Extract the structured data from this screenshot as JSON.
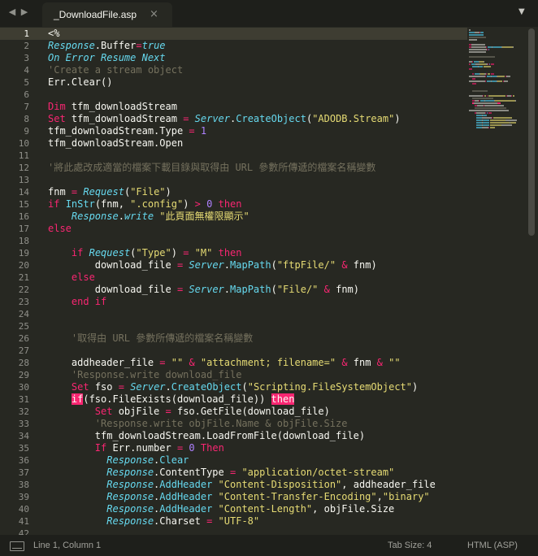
{
  "nav": {
    "back": "◀",
    "forward": "▶"
  },
  "tab": {
    "label": "_DownloadFile.asp",
    "close": "×"
  },
  "tab_menu": "▼",
  "lines": [
    {
      "n": "1",
      "p": [
        [
          "c",
          "<%"
        ]
      ]
    },
    {
      "n": "2",
      "p": [
        [
          "o",
          "Response"
        ],
        [
          "c",
          "."
        ],
        [
          "c",
          "Buffer"
        ],
        [
          "k",
          "="
        ],
        [
          "o",
          "true"
        ]
      ]
    },
    {
      "n": "3",
      "p": [
        [
          "o",
          "On Error Resume Next"
        ]
      ]
    },
    {
      "n": "4",
      "p": [
        [
          "m",
          "'Create a stream object"
        ]
      ]
    },
    {
      "n": "5",
      "p": [
        [
          "c",
          "Err.Clear()"
        ]
      ]
    },
    {
      "n": "6",
      "p": []
    },
    {
      "n": "7",
      "p": [
        [
          "k",
          "Dim"
        ],
        [
          "c",
          " tfm_downloadStream"
        ]
      ]
    },
    {
      "n": "8",
      "p": [
        [
          "k",
          "Set"
        ],
        [
          "c",
          " tfm_downloadStream "
        ],
        [
          "k",
          "="
        ],
        [
          "c",
          " "
        ],
        [
          "o",
          "Server"
        ],
        [
          "c",
          "."
        ],
        [
          "f",
          "CreateObject"
        ],
        [
          "c",
          "("
        ],
        [
          "s",
          "\"ADODB.Stream\""
        ],
        [
          "c",
          ")"
        ]
      ]
    },
    {
      "n": "9",
      "p": [
        [
          "c",
          "tfm_downloadStream.Type "
        ],
        [
          "k",
          "="
        ],
        [
          "c",
          " "
        ],
        [
          "n",
          "1"
        ]
      ]
    },
    {
      "n": "10",
      "p": [
        [
          "c",
          "tfm_downloadStream.Open"
        ]
      ]
    },
    {
      "n": "11",
      "p": []
    },
    {
      "n": "12",
      "p": [
        [
          "m",
          "'將此處改成適當的檔案下載目錄與取得由 URL 參數所傳遞的檔案名稱變數"
        ]
      ]
    },
    {
      "n": "13",
      "p": []
    },
    {
      "n": "14",
      "p": [
        [
          "c",
          "fnm "
        ],
        [
          "k",
          "="
        ],
        [
          "c",
          " "
        ],
        [
          "o",
          "Request"
        ],
        [
          "c",
          "("
        ],
        [
          "s",
          "\"File\""
        ],
        [
          "c",
          ")"
        ]
      ]
    },
    {
      "n": "15",
      "p": [
        [
          "k",
          "if"
        ],
        [
          "c",
          " "
        ],
        [
          "f",
          "InStr"
        ],
        [
          "c",
          "(fnm, "
        ],
        [
          "s",
          "\".config\""
        ],
        [
          "c",
          ") "
        ],
        [
          "k",
          ">"
        ],
        [
          "c",
          " "
        ],
        [
          "n",
          "0"
        ],
        [
          "c",
          " "
        ],
        [
          "k",
          "then"
        ]
      ]
    },
    {
      "n": "16",
      "p": [
        [
          "c",
          "    "
        ],
        [
          "o",
          "Response"
        ],
        [
          "c",
          "."
        ],
        [
          "o",
          "write"
        ],
        [
          "c",
          " "
        ],
        [
          "s",
          "\"此頁面無權限顯示\""
        ]
      ]
    },
    {
      "n": "17",
      "p": [
        [
          "k",
          "else"
        ]
      ]
    },
    {
      "n": "18",
      "p": []
    },
    {
      "n": "19",
      "p": [
        [
          "c",
          "    "
        ],
        [
          "k",
          "if"
        ],
        [
          "c",
          " "
        ],
        [
          "o",
          "Request"
        ],
        [
          "c",
          "("
        ],
        [
          "s",
          "\"Type\""
        ],
        [
          "c",
          ") "
        ],
        [
          "k",
          "="
        ],
        [
          "c",
          " "
        ],
        [
          "s",
          "\"M\""
        ],
        [
          "c",
          " "
        ],
        [
          "k",
          "then"
        ]
      ]
    },
    {
      "n": "20",
      "p": [
        [
          "c",
          "        download_file "
        ],
        [
          "k",
          "="
        ],
        [
          "c",
          " "
        ],
        [
          "o",
          "Server"
        ],
        [
          "c",
          "."
        ],
        [
          "f",
          "MapPath"
        ],
        [
          "c",
          "("
        ],
        [
          "s",
          "\"ftpFile/\""
        ],
        [
          "c",
          " "
        ],
        [
          "k",
          "&"
        ],
        [
          "c",
          " fnm)"
        ]
      ]
    },
    {
      "n": "21",
      "p": [
        [
          "c",
          "    "
        ],
        [
          "k",
          "else"
        ]
      ]
    },
    {
      "n": "22",
      "p": [
        [
          "c",
          "        download_file "
        ],
        [
          "k",
          "="
        ],
        [
          "c",
          " "
        ],
        [
          "o",
          "Server"
        ],
        [
          "c",
          "."
        ],
        [
          "f",
          "MapPath"
        ],
        [
          "c",
          "("
        ],
        [
          "s",
          "\"File/\""
        ],
        [
          "c",
          " "
        ],
        [
          "k",
          "&"
        ],
        [
          "c",
          " fnm)"
        ]
      ]
    },
    {
      "n": "23",
      "p": [
        [
          "c",
          "    "
        ],
        [
          "k",
          "end if"
        ]
      ]
    },
    {
      "n": "24",
      "p": []
    },
    {
      "n": "25",
      "p": []
    },
    {
      "n": "26",
      "p": [
        [
          "c",
          "    "
        ],
        [
          "m",
          "'取得由 URL 參數所傳遞的檔案名稱變數"
        ]
      ]
    },
    {
      "n": "27",
      "p": []
    },
    {
      "n": "28",
      "p": [
        [
          "c",
          "    addheader_file "
        ],
        [
          "k",
          "="
        ],
        [
          "c",
          " "
        ],
        [
          "s",
          "\"\""
        ],
        [
          "c",
          " "
        ],
        [
          "k",
          "&"
        ],
        [
          "c",
          " "
        ],
        [
          "s",
          "\"attachment; filename=\""
        ],
        [
          "c",
          " "
        ],
        [
          "k",
          "&"
        ],
        [
          "c",
          " fnm "
        ],
        [
          "k",
          "&"
        ],
        [
          "c",
          " "
        ],
        [
          "s",
          "\"\""
        ]
      ]
    },
    {
      "n": "29",
      "p": [
        [
          "c",
          "    "
        ],
        [
          "m",
          "'Response.write download_file"
        ]
      ]
    },
    {
      "n": "30",
      "p": [
        [
          "c",
          "    "
        ],
        [
          "k",
          "Set"
        ],
        [
          "c",
          " fso "
        ],
        [
          "k",
          "="
        ],
        [
          "c",
          " "
        ],
        [
          "o",
          "Server"
        ],
        [
          "c",
          "."
        ],
        [
          "f",
          "CreateObject"
        ],
        [
          "c",
          "("
        ],
        [
          "s",
          "\"Scripting.FileSystemObject\""
        ],
        [
          "c",
          ")"
        ]
      ]
    },
    {
      "n": "31",
      "p": [
        [
          "c",
          "    "
        ],
        [
          "e",
          "if"
        ],
        [
          "c",
          "(fso.FileExists(download_file)) "
        ],
        [
          "e",
          "then"
        ]
      ]
    },
    {
      "n": "32",
      "p": [
        [
          "c",
          "        "
        ],
        [
          "k",
          "Set"
        ],
        [
          "c",
          " objFile "
        ],
        [
          "k",
          "="
        ],
        [
          "c",
          " fso.GetFile(download_file)"
        ]
      ]
    },
    {
      "n": "33",
      "p": [
        [
          "c",
          "        "
        ],
        [
          "m",
          "'Response.write objFile.Name & objFile.Size"
        ]
      ]
    },
    {
      "n": "34",
      "p": [
        [
          "c",
          "        tfm_downloadStream.LoadFromFile(download_file)"
        ]
      ]
    },
    {
      "n": "35",
      "p": [
        [
          "c",
          "        "
        ],
        [
          "k",
          "If"
        ],
        [
          "c",
          " Err.number "
        ],
        [
          "k",
          "="
        ],
        [
          "c",
          " "
        ],
        [
          "n",
          "0"
        ],
        [
          "c",
          " "
        ],
        [
          "k",
          "Then"
        ]
      ]
    },
    {
      "n": "36",
      "p": [
        [
          "c",
          "          "
        ],
        [
          "o",
          "Response"
        ],
        [
          "c",
          "."
        ],
        [
          "f",
          "Clear"
        ]
      ]
    },
    {
      "n": "37",
      "p": [
        [
          "c",
          "          "
        ],
        [
          "o",
          "Response"
        ],
        [
          "c",
          ".ContentType "
        ],
        [
          "k",
          "="
        ],
        [
          "c",
          " "
        ],
        [
          "s",
          "\"application/octet-stream\""
        ]
      ]
    },
    {
      "n": "38",
      "p": [
        [
          "c",
          "          "
        ],
        [
          "o",
          "Response"
        ],
        [
          "c",
          "."
        ],
        [
          "f",
          "AddHeader"
        ],
        [
          "c",
          " "
        ],
        [
          "s",
          "\"Content-Disposition\""
        ],
        [
          "c",
          ", addheader_file"
        ]
      ]
    },
    {
      "n": "39",
      "p": [
        [
          "c",
          "          "
        ],
        [
          "o",
          "Response"
        ],
        [
          "c",
          "."
        ],
        [
          "f",
          "AddHeader"
        ],
        [
          "c",
          " "
        ],
        [
          "s",
          "\"Content-Transfer-Encoding\""
        ],
        [
          "c",
          ","
        ],
        [
          "s",
          "\"binary\""
        ]
      ]
    },
    {
      "n": "40",
      "p": [
        [
          "c",
          "          "
        ],
        [
          "o",
          "Response"
        ],
        [
          "c",
          "."
        ],
        [
          "f",
          "AddHeader"
        ],
        [
          "c",
          " "
        ],
        [
          "s",
          "\"Content-Length\""
        ],
        [
          "c",
          ", objFile.Size"
        ]
      ]
    },
    {
      "n": "41",
      "p": [
        [
          "c",
          "          "
        ],
        [
          "o",
          "Response"
        ],
        [
          "c",
          ".Charset "
        ],
        [
          "k",
          "="
        ],
        [
          "c",
          " "
        ],
        [
          "s",
          "\"UTF-8\""
        ]
      ]
    },
    {
      "n": "42",
      "p": []
    }
  ],
  "current_line": "1",
  "syntax_colors": {
    "background": "#272822",
    "text": "#f8f8f2",
    "keyword": "#f92672",
    "string": "#e6db74",
    "number": "#ae81ff",
    "comment": "#75715e",
    "object": "#66d9ef"
  },
  "status": {
    "icon": "panel-toggle-icon",
    "position": "Line 1, Column 1",
    "tab_size": "Tab Size: 4",
    "syntax": "HTML (ASP)"
  }
}
